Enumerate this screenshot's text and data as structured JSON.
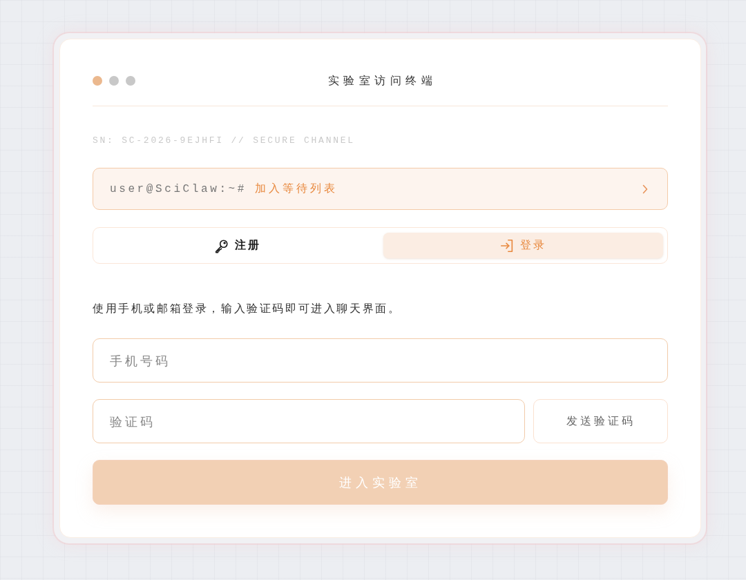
{
  "window": {
    "title": "实验室访问终端",
    "dots": [
      {
        "color": "#ebb88e"
      },
      {
        "color": "#c8c8c8"
      },
      {
        "color": "#c8c8c8"
      }
    ]
  },
  "serial": "SN: SC-2026-9EJHFI // SECURE CHANNEL",
  "waitlist": {
    "prompt": "user@SciClaw:~#",
    "label": "加入等待列表"
  },
  "tabs": [
    {
      "label": "注册",
      "kind": "key",
      "selected": false
    },
    {
      "label": "登录",
      "kind": "login",
      "selected": true
    }
  ],
  "description": "使用手机或邮箱登录，输入验证码即可进入聊天界面。",
  "phone": {
    "placeholder": "手机号码"
  },
  "code": {
    "placeholder": "验证码",
    "button": "发送验证码"
  },
  "submit": {
    "label": "进入实验室",
    "disabled": true
  }
}
